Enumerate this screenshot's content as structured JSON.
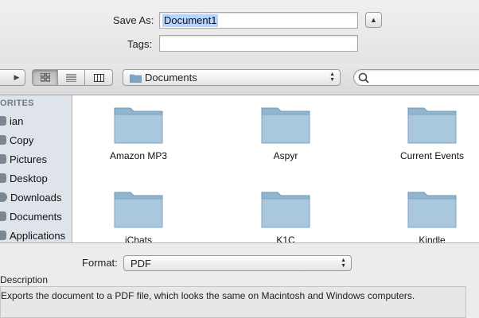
{
  "save_as": {
    "label": "Save As:",
    "value": "Document1"
  },
  "tags": {
    "label": "Tags:",
    "value": ""
  },
  "location": {
    "label": "Documents"
  },
  "search": {
    "value": ""
  },
  "sidebar": {
    "heading": "ORITES",
    "items": [
      {
        "label": "ian",
        "icon": "home-icon"
      },
      {
        "label": "Copy",
        "icon": "folder-icon"
      },
      {
        "label": "Pictures",
        "icon": "pictures-icon"
      },
      {
        "label": "Desktop",
        "icon": "desktop-icon"
      },
      {
        "label": "Downloads",
        "icon": "downloads-icon"
      },
      {
        "label": "Documents",
        "icon": "documents-icon"
      },
      {
        "label": "Applications",
        "icon": "applications-icon"
      }
    ]
  },
  "files": [
    {
      "label": "Amazon MP3"
    },
    {
      "label": "Aspyr"
    },
    {
      "label": "Current Events"
    },
    {
      "label": "iChats"
    },
    {
      "label": "K1C"
    },
    {
      "label": "Kindle"
    }
  ],
  "format": {
    "label": "Format:",
    "value": "PDF"
  },
  "description": {
    "label": "Description",
    "text": "Exports the document to a PDF file, which looks the same on Macintosh and Windows computers."
  },
  "colors": {
    "selection": "#b5d5ff",
    "folder": "#8fb5d0",
    "sidebar": "#dee4ea"
  }
}
